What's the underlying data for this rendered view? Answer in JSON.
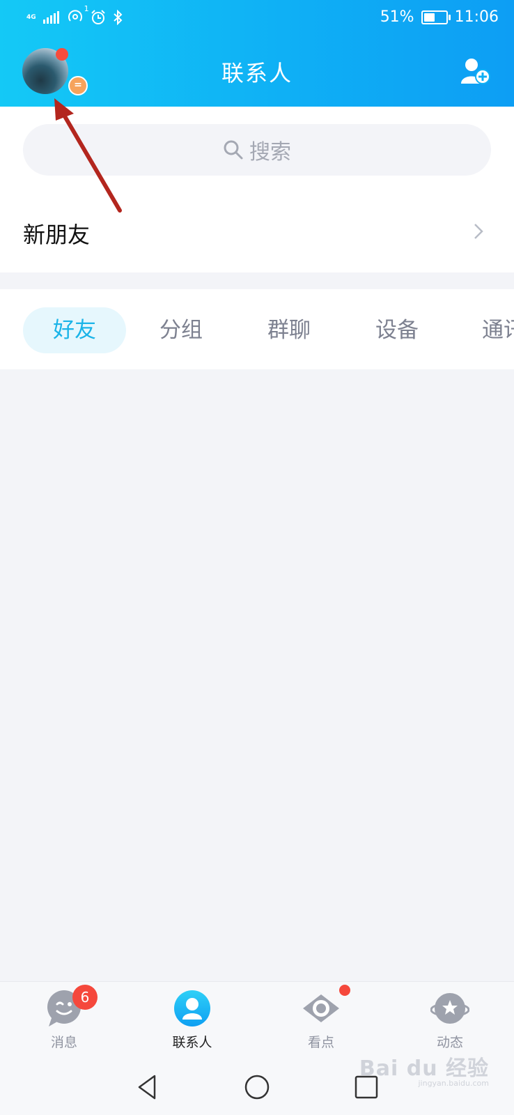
{
  "status_bar": {
    "network": "4G",
    "hotspot_count": "1",
    "battery_percent": "51%",
    "battery_level": 0.51,
    "time": "11:06"
  },
  "header": {
    "title": "联系人",
    "avatar_badge_symbol": "="
  },
  "search": {
    "placeholder": "搜索"
  },
  "new_friends": {
    "label": "新朋友"
  },
  "tabs": [
    {
      "label": "好友",
      "active": true
    },
    {
      "label": "分组",
      "active": false
    },
    {
      "label": "群聊",
      "active": false
    },
    {
      "label": "设备",
      "active": false
    },
    {
      "label": "通讯录",
      "active": false
    }
  ],
  "bottom_nav": [
    {
      "label": "消息",
      "icon": "message-icon",
      "badge": "6"
    },
    {
      "label": "联系人",
      "icon": "contacts-icon",
      "active": true
    },
    {
      "label": "看点",
      "icon": "eye-icon",
      "dot": true
    },
    {
      "label": "动态",
      "icon": "planet-icon"
    }
  ],
  "watermark": {
    "text": "Bai du 经验",
    "sub": "jingyan.baidu.com"
  },
  "colors": {
    "header_start": "#14c9f6",
    "header_end": "#0d9ef4",
    "active_tab_text": "#1bb4e8",
    "badge_red": "#f5483c",
    "annotation_arrow": "#b3261e"
  }
}
